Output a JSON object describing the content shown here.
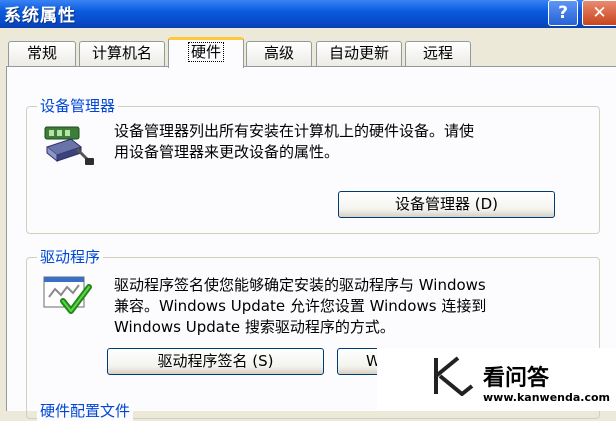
{
  "window": {
    "title": "系统属性",
    "help_glyph": "?",
    "close_glyph": "✕"
  },
  "tabs": [
    {
      "label": "常规",
      "active": false
    },
    {
      "label": "计算机名",
      "active": false
    },
    {
      "label": "硬件",
      "active": true
    },
    {
      "label": "高级",
      "active": false
    },
    {
      "label": "自动更新",
      "active": false
    },
    {
      "label": "远程",
      "active": false
    }
  ],
  "device_manager": {
    "title": "设备管理器",
    "line1": "设备管理器列出所有安装在计算机上的硬件设备。请使",
    "line2": "用设备管理器来更改设备的属性。",
    "button_label": "设备管理器 (D)",
    "icon": "device-manager-icon"
  },
  "drivers": {
    "title": "驱动程序",
    "line1": "驱动程序签名使您能够确定安装的驱动程序与 Windows",
    "line2": "兼容。Windows Update 允许您设置 Windows 连接到",
    "line3": "Windows Update 搜索驱动程序的方式。",
    "signing_button_label": "驱动程序签名 (S)",
    "update_button_label": "W",
    "icon": "driver-signing-icon"
  },
  "hardware_profiles": {
    "title": "硬件配置文件"
  },
  "watermark": {
    "name": "看问答",
    "url": "www.kanwenda.com"
  },
  "colors": {
    "title_bar": "#0A5BDC",
    "group_label": "#0046D5",
    "tab_highlight": "#FFC83C",
    "face": "#ECE9D8"
  }
}
